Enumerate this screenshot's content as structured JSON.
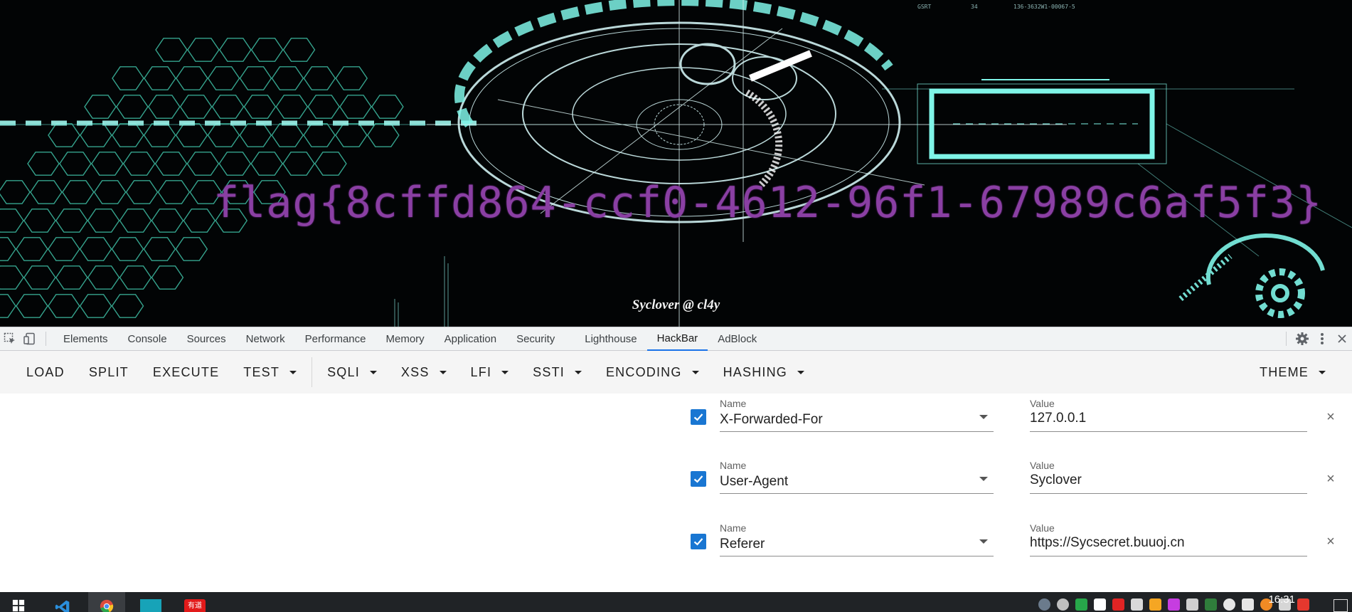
{
  "page": {
    "flag_text": "flag{8cffd864-ccf0-4612-96f1-67989c6af5f3}",
    "signature": "Syclover @ cl4y"
  },
  "devtools": {
    "tabs": [
      "Elements",
      "Console",
      "Sources",
      "Network",
      "Performance",
      "Memory",
      "Application",
      "Security",
      "Lighthouse",
      "HackBar",
      "AdBlock"
    ],
    "active_tab": "HackBar"
  },
  "hackbar": {
    "toolbar": {
      "load": "LOAD",
      "split": "SPLIT",
      "execute": "EXECUTE",
      "test": "TEST",
      "sqli": "SQLI",
      "xss": "XSS",
      "lfi": "LFI",
      "ssti": "SSTI",
      "encoding": "ENCODING",
      "hashing": "HASHING",
      "theme": "THEME"
    },
    "headers": [
      {
        "enabled": true,
        "name_label": "Name",
        "name": "X-Forwarded-For",
        "value_label": "Value",
        "value": "127.0.0.1"
      },
      {
        "enabled": true,
        "name_label": "Name",
        "name": "User-Agent",
        "value_label": "Value",
        "value": "Syclover"
      },
      {
        "enabled": true,
        "name_label": "Name",
        "name": "Referer",
        "value_label": "Value",
        "value": "https://Sycsecret.buuoj.cn"
      }
    ],
    "remove_symbol": "×"
  },
  "taskbar": {
    "apps": [
      "windows-start",
      "vscode",
      "chrome",
      "terminal",
      "youdao"
    ],
    "app_labels": {
      "youdao": "有道"
    },
    "active_app": "chrome",
    "clock": "16:31"
  },
  "colors": {
    "flag": "#8a3fa3",
    "hud_cyan": "#7ff5e8",
    "accent_blue": "#1a73e8",
    "checkbox": "#1976d2"
  }
}
